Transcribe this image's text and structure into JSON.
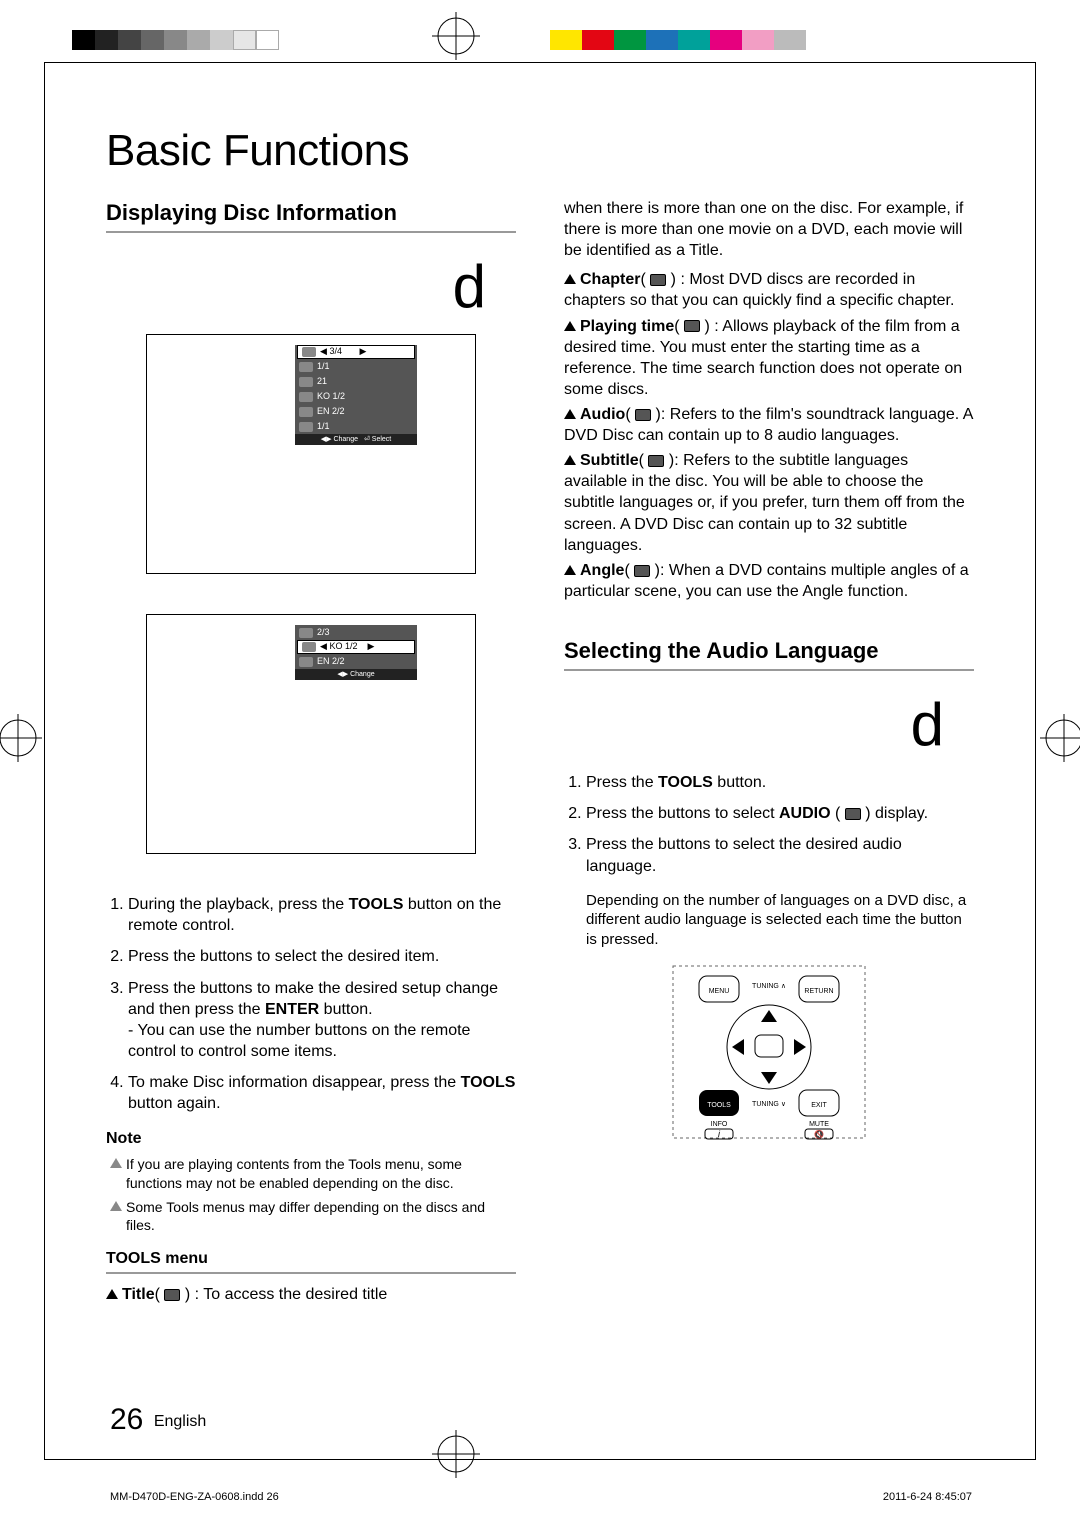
{
  "page_title": "Basic Functions",
  "section1_title": "Displaying Disc Information",
  "glyph": "d",
  "osd1": {
    "rows": [
      "3/4",
      "1/1",
      "21",
      "KO 1/2",
      "EN 2/2",
      "1/1"
    ],
    "foot_change": "Change",
    "foot_select": "Select"
  },
  "osd2": {
    "rows": [
      "2/3",
      "KO 1/2",
      "EN 2/2"
    ],
    "foot_change": "Change"
  },
  "steps_left": [
    "During the playback, press the TOOLS button on the remote control.",
    "Press the buttons to select the desired item.",
    "Press the buttons to make the desired setup change and then press the ENTER button.\n- You can use the number buttons on the remote control to control some items.",
    "To make Disc information disappear, press the TOOLS button again."
  ],
  "note_label": "Note",
  "notes": [
    "If you are playing contents from the Tools menu, some functions may not be enabled depending on the disc.",
    "Some Tools menus may differ depending on the discs and ﬁles."
  ],
  "tools_menu_label": "TOOLS menu",
  "tools_title_entry_label": "Title",
  "tools_title_entry_desc": " : To access the desired title",
  "right_intro": "when there is more than one on the disc. For example, if there is more than one movie on a DVD, each movie will be identiﬁed as a Title.",
  "defs": [
    {
      "label": "Chapter",
      "desc": " : Most DVD discs are recorded in chapters so that you can quickly ﬁnd a speciﬁc chapter."
    },
    {
      "label": "Playing time",
      "desc": " : Allows playback of the ﬁlm from a desired time. You must enter the starting time as a reference. The time search function does not operate on some discs."
    },
    {
      "label": "Audio",
      "desc": ": Refers to the ﬁlm's soundtrack language. A DVD Disc can contain up to 8 audio languages."
    },
    {
      "label": "Subtitle",
      "desc": ": Refers to the subtitle languages available in the disc. You will be able to choose the subtitle languages or, if you prefer, turn them off from the screen. A DVD Disc can contain up to 32 subtitle languages."
    },
    {
      "label": "Angle",
      "desc": ": When a DVD contains multiple angles of a particular scene, you can use the Angle function."
    }
  ],
  "section2_title": "Selecting the Audio Language",
  "steps_right": [
    {
      "pre": "Press the ",
      "bold": "TOOLS",
      "post": " button."
    },
    {
      "pre": "Press the buttons to select ",
      "bold": "AUDIO",
      "post": " (        ) display.",
      "icon": true
    },
    {
      "pre": "Press the buttons to select the desired audio language.",
      "bold": "",
      "post": ""
    }
  ],
  "right_subnote": "Depending on the number of languages on a DVD disc, a different audio language is selected each time the button is pressed.",
  "remote": {
    "top": "TUNING",
    "menu": "MENU",
    "ret": "RETURN",
    "tools": "TOOLS",
    "exit": "EXIT",
    "info": "INFO",
    "mute": "MUTE"
  },
  "page_number": "26",
  "page_lang": "English",
  "footer_file": "MM-D470D-ENG-ZA-0608.indd   26",
  "footer_date": "2011-6-24   8:45:07"
}
